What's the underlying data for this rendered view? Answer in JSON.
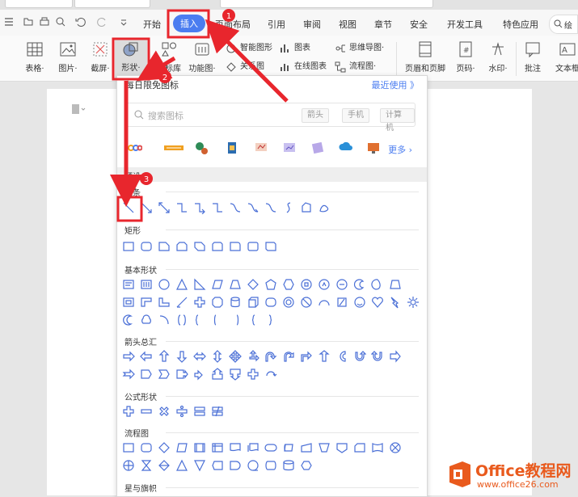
{
  "menu": {
    "items": [
      "开始",
      "插入",
      "页面布局",
      "引用",
      "审阅",
      "视图",
      "章节",
      "安全",
      "开发工具",
      "特色应用"
    ],
    "search_label": "绘"
  },
  "ribbon": {
    "table": "表格·",
    "picture": "图片·",
    "screenshot": "截屏·",
    "shape": "形状·",
    "icon_lib": "图标库",
    "func_chart": "功能图·",
    "smart_shape": "智能图形",
    "chart": "图表",
    "mindmap": "思维导图·",
    "relation": "关系图",
    "online_chart": "在线图表",
    "flowchart": "流程图·",
    "header_footer": "页眉和页脚",
    "page_num": "页码·",
    "watermark": "水印·",
    "comment": "批注",
    "textbox": "文本框"
  },
  "panel": {
    "title": "每日限免图标",
    "recent": "最近使用 》",
    "search_placeholder": "搜索图标",
    "chips": [
      "箭头",
      "手机",
      "计算机"
    ],
    "more": "更多 ›",
    "sections": {
      "presets": "预设",
      "lines": "线条",
      "rect": "矩形",
      "basic": "基本形状",
      "arrows": "箭头总汇",
      "formula": "公式形状",
      "flow": "流程图",
      "stars": "星与旗帜"
    }
  },
  "annotations": [
    "1",
    "2",
    "3"
  ],
  "watermark": {
    "brand": "Office教程网",
    "url": "www.office26.com"
  },
  "colors": {
    "accent": "#4b7df0",
    "annotation_red": "#e8262d",
    "shape_stroke": "#4a6fd6",
    "watermark_orange": "#e95a1d"
  }
}
